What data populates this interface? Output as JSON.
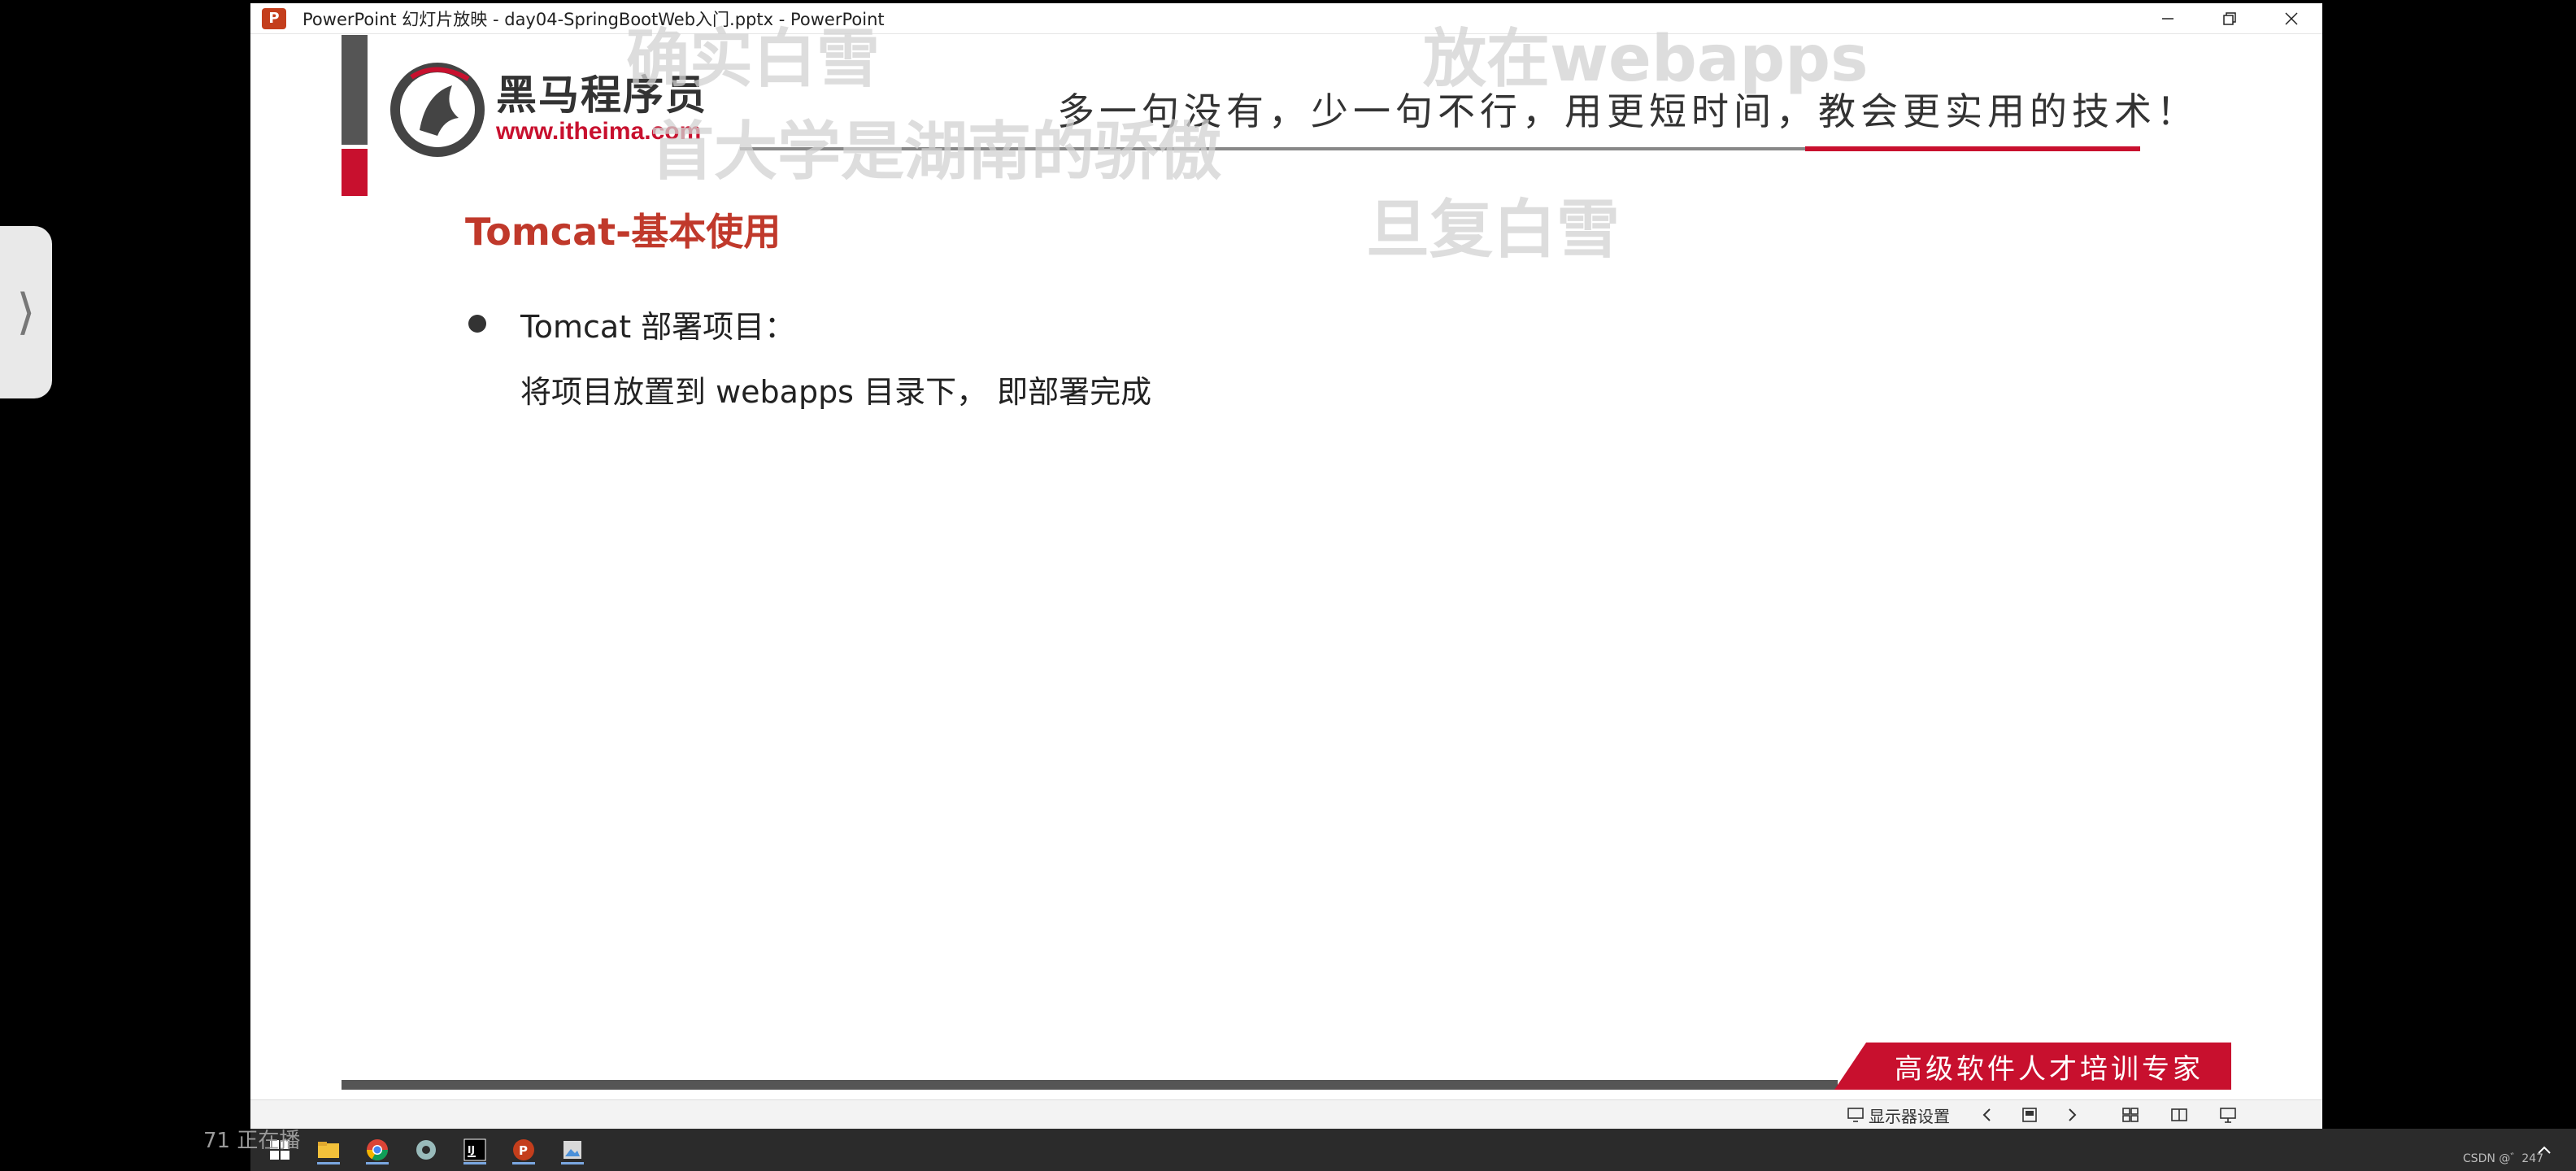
{
  "window": {
    "title": "PowerPoint 幻灯片放映  -  day04-SpringBootWeb入门.pptx - PowerPoint",
    "app_icon": "powerpoint-icon",
    "controls": [
      "minimize-icon",
      "restore-icon",
      "close-icon"
    ]
  },
  "slide": {
    "logo_name": "黑马程序员",
    "logo_url": "www.itheima.com",
    "slogan": "多一句没有，少一句不行，用更短时间，教会更实用的技术！",
    "heading": "Tomcat-基本使用",
    "bullet": "Tomcat 部署项目：",
    "sub_text": "将项目放置到 webapps 目录下， 即部署完成",
    "footer": "高级软件人才培训专家",
    "colors": {
      "accent_red": "#c8102e",
      "heading_red": "#c0392b",
      "bar_gray": "#555555"
    }
  },
  "overlays": {
    "subtitle_1": "确实白雪",
    "subtitle_2": "放在webapps",
    "subtitle_3": "首大学是湖南的骄傲",
    "subtitle_4": "旦复白雪"
  },
  "statusbar": {
    "display_settings": "显示器设置",
    "icons": [
      "monitor-icon",
      "prev-icon",
      "next-icon",
      "normal-view-icon",
      "slide-sorter-icon",
      "reading-view-icon",
      "slideshow-icon"
    ]
  },
  "taskbar": {
    "icons": [
      "windows-start-icon",
      "file-explorer-icon",
      "chrome-icon",
      "app-icon",
      "intellij-icon",
      "powerpoint-icon",
      "photo-icon"
    ],
    "left_overlay": "71  正在播",
    "corner_text": "CSDN @゛247"
  }
}
